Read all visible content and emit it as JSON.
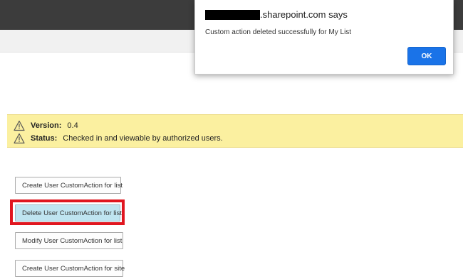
{
  "dialog": {
    "title_domain": ".sharepoint.com says",
    "message": "Custom action deleted successfully for My List",
    "ok_label": "OK"
  },
  "status": {
    "version_label": "Version:",
    "version_value": "0.4",
    "status_label": "Status:",
    "status_value": "Checked in and viewable by authorized users."
  },
  "buttons": {
    "create_list": "Create User CustomAction for list",
    "delete_list": "Delete User CustomAction for list",
    "modify_list": "Modify User CustomAction for list",
    "create_site": "Create User CustomAction for site"
  },
  "icons": {
    "warning": "warning-triangle-icon"
  },
  "colors": {
    "top_bar": "#3c3c3c",
    "banner_bg": "#fbf0a0",
    "selected_button": "#bfe4f0",
    "highlight_border": "#e0161f",
    "ok_button": "#1a73e8"
  }
}
